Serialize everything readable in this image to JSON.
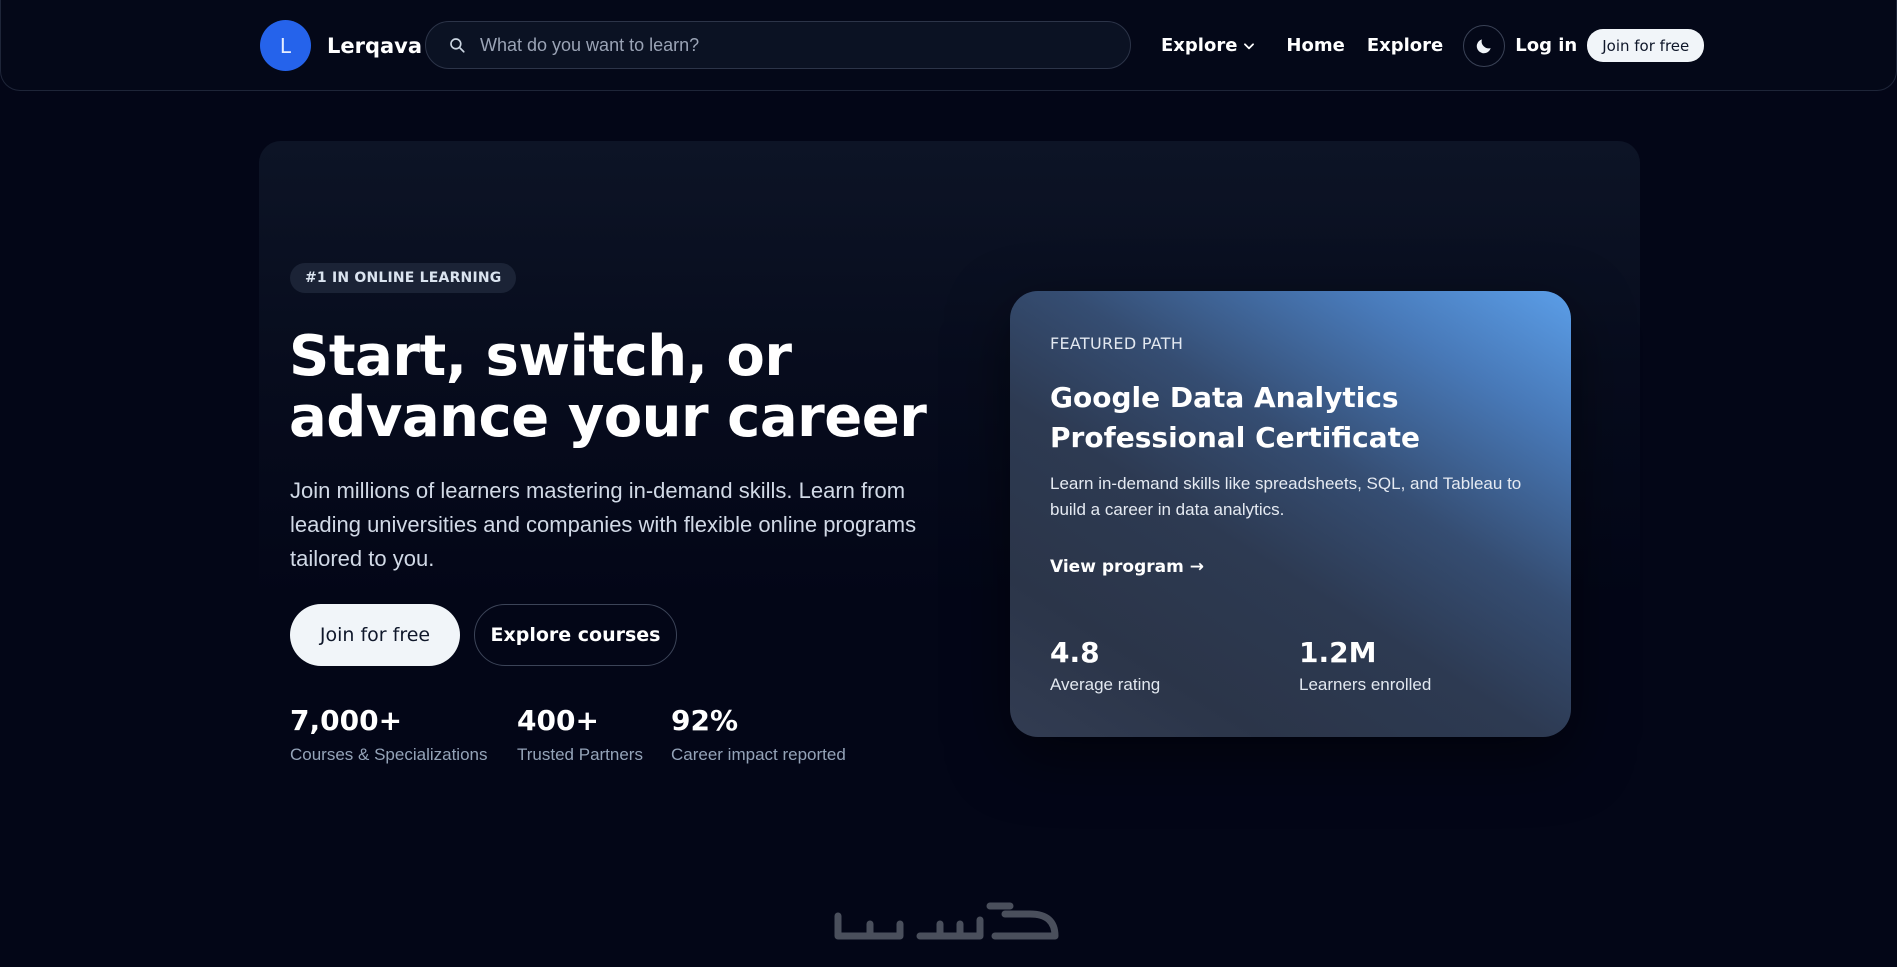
{
  "header": {
    "brand_initial": "L",
    "brand_name": "Lerqava",
    "search_placeholder": "What do you want to learn?",
    "explore_dropdown": "Explore",
    "nav_home": "Home",
    "nav_explore": "Explore",
    "login": "Log in",
    "join": "Join for free",
    "icons": [
      "search-icon",
      "chevron-down-icon",
      "moon-icon"
    ]
  },
  "hero": {
    "badge": "#1 IN ONLINE LEARNING",
    "title_line1": "Start, switch, or",
    "title_line2": "advance your career",
    "subtitle": "Join millions of learners mastering in-demand skills. Learn from leading universities and companies with flexible online programs tailored to you.",
    "primary_cta": "Join for free",
    "secondary_cta": "Explore courses",
    "stats": [
      {
        "value": "7,000+",
        "label": "Courses & Specializations"
      },
      {
        "value": "400+",
        "label": "Trusted Partners"
      },
      {
        "value": "92%",
        "label": "Career impact reported"
      }
    ]
  },
  "featured": {
    "eyebrow": "FEATURED PATH",
    "title": "Google Data Analytics Professional Certificate",
    "description": "Learn in-demand skills like spreadsheets, SQL, and Tableau to build a career in data analytics.",
    "link": "View program →",
    "stats": [
      {
        "value": "4.8",
        "label": "Average rating"
      },
      {
        "value": "1.2M",
        "label": "Learners enrolled"
      }
    ]
  },
  "colors": {
    "background": "#030617",
    "accent_blue": "#2563eb",
    "card_gradient_start": "#5b9ee8",
    "card_gradient_end": "#2b3549",
    "button_light": "#f1f5f9"
  },
  "watermark": {
    "text": "خمسات"
  }
}
